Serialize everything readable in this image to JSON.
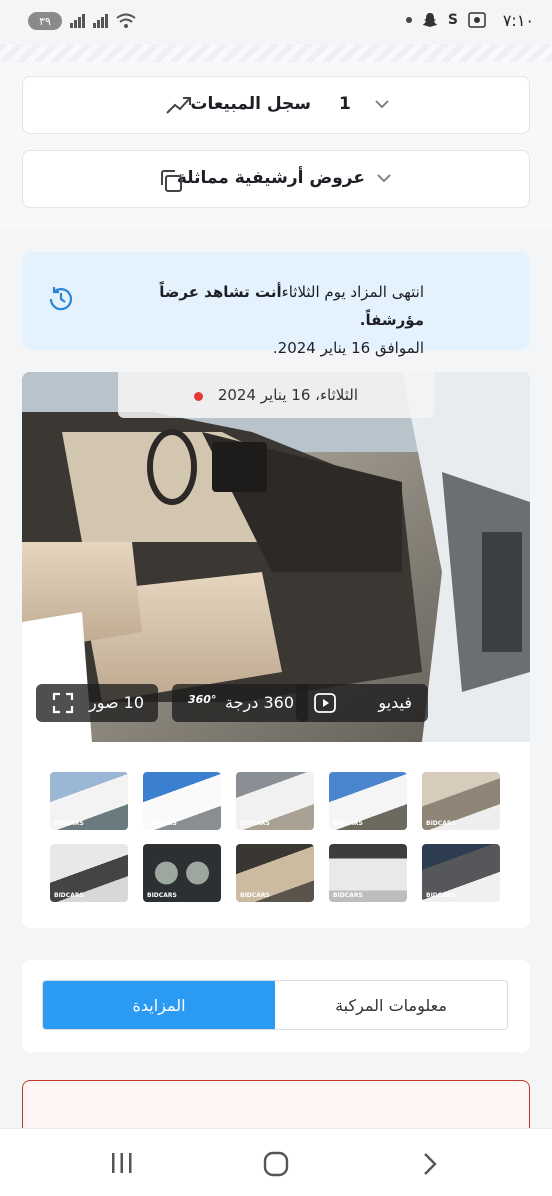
{
  "status_bar": {
    "time": "٧:١٠",
    "battery": "٣٩"
  },
  "accordions": [
    {
      "label": "سجل المبيعات",
      "count": "1",
      "icon": "trending-up-icon"
    },
    {
      "label": "عروض أرشيفية مماثلة",
      "icon": "copy-icon"
    }
  ],
  "notice": {
    "line1_prefix": "انتهى المزاد يوم الثلاثاء",
    "line1_bold": "أنت تشاهد عرضاً مؤرشفاً.",
    "line2": "الموافق 16 يناير 2024."
  },
  "gallery": {
    "date_label": "الثلاثاء، 16 يناير 2024",
    "video_label": "فيديو",
    "degree_label": "360 درجة",
    "degree_icon_text": "360°",
    "photos_label": "10 صور",
    "watermark": "BIDCARS",
    "thumbnails_count": 10
  },
  "tabs": {
    "vehicle_info": "معلومات المركبة",
    "auction": "المزايدة",
    "active": "auction"
  },
  "colors": {
    "accent": "#2b9af3",
    "notice_bg": "#e4f2fd",
    "live_dot": "#e53935"
  }
}
